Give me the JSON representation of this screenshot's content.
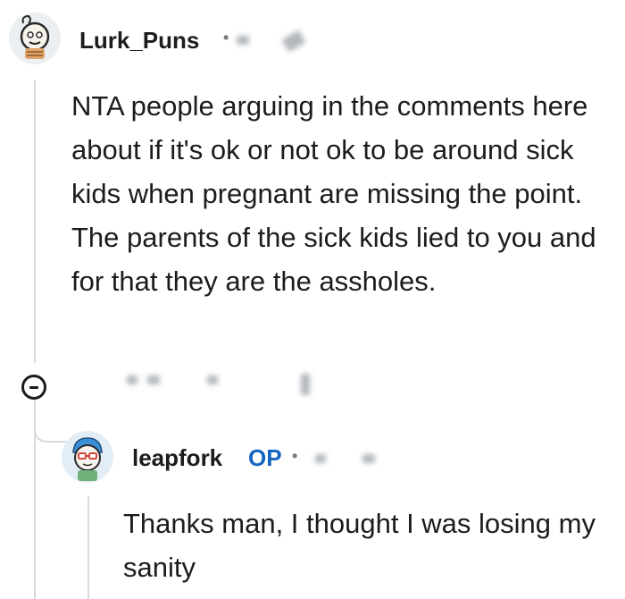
{
  "comment": {
    "username": "Lurk_Puns",
    "avatar_icon": "cartoon-avatar-icon",
    "meta_separator": "•",
    "body": "NTA people arguing in the comments here about if it's ok or not ok to be around sick kids when pregnant are missing the point. The parents of the sick kids lied to you and for that they are the assholes.",
    "actions": {
      "collapse_icon": "minus-circle-icon"
    }
  },
  "reply": {
    "username": "leapfork",
    "badge": "OP",
    "meta_separator": "•",
    "avatar_icon": "cartoon-avatar-icon",
    "body": "Thanks man, I thought I was losing my sanity"
  },
  "colors": {
    "text": "#1c1c1c",
    "op_badge": "#1565c0",
    "thread_line": "#d9d9d9",
    "meta": "#7c7c7c"
  }
}
